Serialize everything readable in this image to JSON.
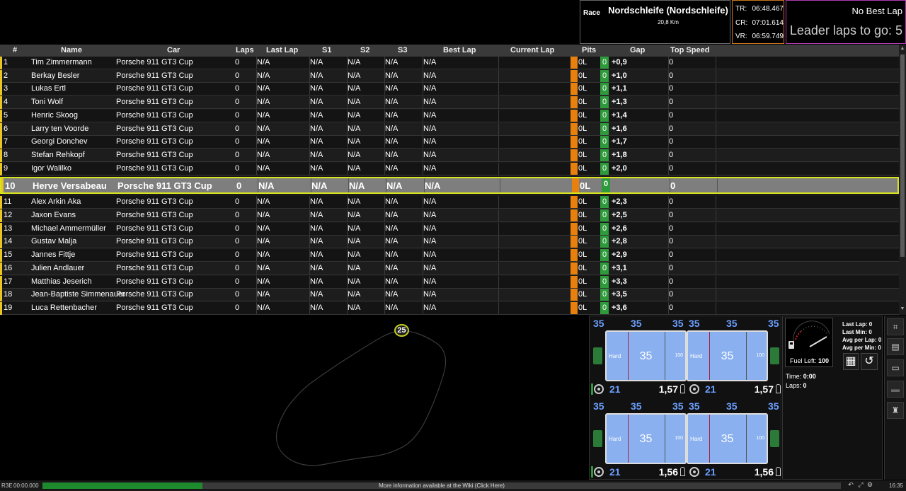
{
  "session": {
    "type": "Race",
    "track": "Nordschleife (Nordschleife)",
    "length": "20,8 Km"
  },
  "records": [
    {
      "label": "TR:",
      "value": "06:48.467"
    },
    {
      "label": "CR:",
      "value": "07:01.614"
    },
    {
      "label": "VR:",
      "value": "06:59.749"
    }
  ],
  "best": {
    "best_lap_text": "No Best Lap",
    "leader_laps_text": "Leader laps to go: 5"
  },
  "table": {
    "headers": {
      "pos": "#",
      "name": "Name",
      "car": "Car",
      "laps": "Laps",
      "last_lap": "Last Lap",
      "s1": "S1",
      "s2": "S2",
      "s3": "S3",
      "best_lap": "Best Lap",
      "current_lap": "Current Lap",
      "pits": "Pits",
      "gap": "Gap",
      "top_speed": "Top Speed"
    },
    "rows": [
      {
        "pos": "1",
        "name": "Tim Zimmermann",
        "car": "Porsche 911 GT3 Cup",
        "laps": "0",
        "last_lap": "N/A",
        "s1": "N/A",
        "s2": "N/A",
        "s3": "N/A",
        "best_lap": "N/A",
        "fuel": "0L",
        "pits": "0",
        "gap": "+0,9",
        "top_speed": "0"
      },
      {
        "pos": "2",
        "name": "Berkay Besler",
        "car": "Porsche 911 GT3 Cup",
        "laps": "0",
        "last_lap": "N/A",
        "s1": "N/A",
        "s2": "N/A",
        "s3": "N/A",
        "best_lap": "N/A",
        "fuel": "0L",
        "pits": "0",
        "gap": "+1,0",
        "top_speed": "0"
      },
      {
        "pos": "3",
        "name": "Lukas Ertl",
        "car": "Porsche 911 GT3 Cup",
        "laps": "0",
        "last_lap": "N/A",
        "s1": "N/A",
        "s2": "N/A",
        "s3": "N/A",
        "best_lap": "N/A",
        "fuel": "0L",
        "pits": "0",
        "gap": "+1,1",
        "top_speed": "0"
      },
      {
        "pos": "4",
        "name": "Toni Wolf",
        "car": "Porsche 911 GT3 Cup",
        "laps": "0",
        "last_lap": "N/A",
        "s1": "N/A",
        "s2": "N/A",
        "s3": "N/A",
        "best_lap": "N/A",
        "fuel": "0L",
        "pits": "0",
        "gap": "+1,3",
        "top_speed": "0"
      },
      {
        "pos": "5",
        "name": "Henric Skoog",
        "car": "Porsche 911 GT3 Cup",
        "laps": "0",
        "last_lap": "N/A",
        "s1": "N/A",
        "s2": "N/A",
        "s3": "N/A",
        "best_lap": "N/A",
        "fuel": "0L",
        "pits": "0",
        "gap": "+1,4",
        "top_speed": "0"
      },
      {
        "pos": "6",
        "name": "Larry ten Voorde",
        "car": "Porsche 911 GT3 Cup",
        "laps": "0",
        "last_lap": "N/A",
        "s1": "N/A",
        "s2": "N/A",
        "s3": "N/A",
        "best_lap": "N/A",
        "fuel": "0L",
        "pits": "0",
        "gap": "+1,6",
        "top_speed": "0"
      },
      {
        "pos": "7",
        "name": "Georgi Donchev",
        "car": "Porsche 911 GT3 Cup",
        "laps": "0",
        "last_lap": "N/A",
        "s1": "N/A",
        "s2": "N/A",
        "s3": "N/A",
        "best_lap": "N/A",
        "fuel": "0L",
        "pits": "0",
        "gap": "+1,7",
        "top_speed": "0"
      },
      {
        "pos": "8",
        "name": "Stefan Rehkopf",
        "car": "Porsche 911 GT3 Cup",
        "laps": "0",
        "last_lap": "N/A",
        "s1": "N/A",
        "s2": "N/A",
        "s3": "N/A",
        "best_lap": "N/A",
        "fuel": "0L",
        "pits": "0",
        "gap": "+1,8",
        "top_speed": "0"
      },
      {
        "pos": "9",
        "name": "Igor Walilko",
        "car": "Porsche 911 GT3 Cup",
        "laps": "0",
        "last_lap": "N/A",
        "s1": "N/A",
        "s2": "N/A",
        "s3": "N/A",
        "best_lap": "N/A",
        "fuel": "0L",
        "pits": "0",
        "gap": "+2,0",
        "top_speed": "0"
      },
      {
        "pos": "10",
        "name": "Herve Versabeau",
        "car": "Porsche 911 GT3 Cup",
        "laps": "0",
        "last_lap": "N/A",
        "s1": "N/A",
        "s2": "N/A",
        "s3": "N/A",
        "best_lap": "N/A",
        "fuel": "0L",
        "pits": "0",
        "gap": "",
        "top_speed": "0",
        "player": true
      },
      {
        "pos": "11",
        "name": "Alex Arkin Aka",
        "car": "Porsche 911 GT3 Cup",
        "laps": "0",
        "last_lap": "N/A",
        "s1": "N/A",
        "s2": "N/A",
        "s3": "N/A",
        "best_lap": "N/A",
        "fuel": "0L",
        "pits": "0",
        "gap": "+2,3",
        "top_speed": "0"
      },
      {
        "pos": "12",
        "name": "Jaxon Evans",
        "car": "Porsche 911 GT3 Cup",
        "laps": "0",
        "last_lap": "N/A",
        "s1": "N/A",
        "s2": "N/A",
        "s3": "N/A",
        "best_lap": "N/A",
        "fuel": "0L",
        "pits": "0",
        "gap": "+2,5",
        "top_speed": "0"
      },
      {
        "pos": "13",
        "name": "Michael Ammermüller",
        "car": "Porsche 911 GT3 Cup",
        "laps": "0",
        "last_lap": "N/A",
        "s1": "N/A",
        "s2": "N/A",
        "s3": "N/A",
        "best_lap": "N/A",
        "fuel": "0L",
        "pits": "0",
        "gap": "+2,6",
        "top_speed": "0"
      },
      {
        "pos": "14",
        "name": "Gustav Malja",
        "car": "Porsche 911 GT3 Cup",
        "laps": "0",
        "last_lap": "N/A",
        "s1": "N/A",
        "s2": "N/A",
        "s3": "N/A",
        "best_lap": "N/A",
        "fuel": "0L",
        "pits": "0",
        "gap": "+2,8",
        "top_speed": "0"
      },
      {
        "pos": "15",
        "name": "Jannes Fittje",
        "car": "Porsche 911 GT3 Cup",
        "laps": "0",
        "last_lap": "N/A",
        "s1": "N/A",
        "s2": "N/A",
        "s3": "N/A",
        "best_lap": "N/A",
        "fuel": "0L",
        "pits": "0",
        "gap": "+2,9",
        "top_speed": "0"
      },
      {
        "pos": "16",
        "name": "Julien Andlauer",
        "car": "Porsche 911 GT3 Cup",
        "laps": "0",
        "last_lap": "N/A",
        "s1": "N/A",
        "s2": "N/A",
        "s3": "N/A",
        "best_lap": "N/A",
        "fuel": "0L",
        "pits": "0",
        "gap": "+3,1",
        "top_speed": "0"
      },
      {
        "pos": "17",
        "name": "Matthias Jeserich",
        "car": "Porsche 911 GT3 Cup",
        "laps": "0",
        "last_lap": "N/A",
        "s1": "N/A",
        "s2": "N/A",
        "s3": "N/A",
        "best_lap": "N/A",
        "fuel": "0L",
        "pits": "0",
        "gap": "+3,3",
        "top_speed": "0"
      },
      {
        "pos": "18",
        "name": "Jean-Baptiste Simmenauer",
        "car": "Porsche 911 GT3 Cup",
        "laps": "0",
        "last_lap": "N/A",
        "s1": "N/A",
        "s2": "N/A",
        "s3": "N/A",
        "best_lap": "N/A",
        "fuel": "0L",
        "pits": "0",
        "gap": "+3,5",
        "top_speed": "0"
      },
      {
        "pos": "19",
        "name": "Luca Rettenbacher",
        "car": "Porsche 911 GT3 Cup",
        "laps": "0",
        "last_lap": "N/A",
        "s1": "N/A",
        "s2": "N/A",
        "s3": "N/A",
        "best_lap": "N/A",
        "fuel": "0L",
        "pits": "0",
        "gap": "+3,6",
        "top_speed": "0"
      }
    ]
  },
  "map": {
    "car_number": "25"
  },
  "tyres": [
    {
      "temps": [
        "35",
        "35",
        "35"
      ],
      "compound": "Hard",
      "core": "35",
      "wear": "100",
      "brake_temp": "21",
      "pressure": "1,57"
    },
    {
      "temps": [
        "35",
        "35",
        "35"
      ],
      "compound": "Hard",
      "core": "35",
      "wear": "100",
      "brake_temp": "21",
      "pressure": "1,57"
    },
    {
      "temps": [
        "35",
        "35",
        "35"
      ],
      "compound": "Hard",
      "core": "35",
      "wear": "100",
      "brake_temp": "21",
      "pressure": "1,56"
    },
    {
      "temps": [
        "35",
        "35",
        "35"
      ],
      "compound": "Hard",
      "core": "35",
      "wear": "100",
      "brake_temp": "21",
      "pressure": "1,56"
    }
  ],
  "fuel": {
    "fuel_left_label": "Fuel Left:",
    "fuel_left_value": "100",
    "stats": [
      {
        "label": "Last Lap:",
        "value": "0"
      },
      {
        "label": "Last Min:",
        "value": "0"
      },
      {
        "label": "Avg per Lap:",
        "value": "0"
      },
      {
        "label": "Avg per Min:",
        "value": "0"
      }
    ],
    "time_label": "Time:",
    "time_value": "0:00",
    "laps_label": "Laps:",
    "laps_value": "0"
  },
  "statusbar": {
    "version": "R3E",
    "elapsed": "00:00.000",
    "message": "More information available at the Wiki (Click Here)",
    "progress": 0.2,
    "clock": "16:35"
  },
  "colors": {
    "position_bar": "#e8c520",
    "pit_bar": "#e8800e",
    "pit_count": "#2f9a3c",
    "player_border": "#d7e41c",
    "tyre_temp": "#6ca0ff"
  }
}
